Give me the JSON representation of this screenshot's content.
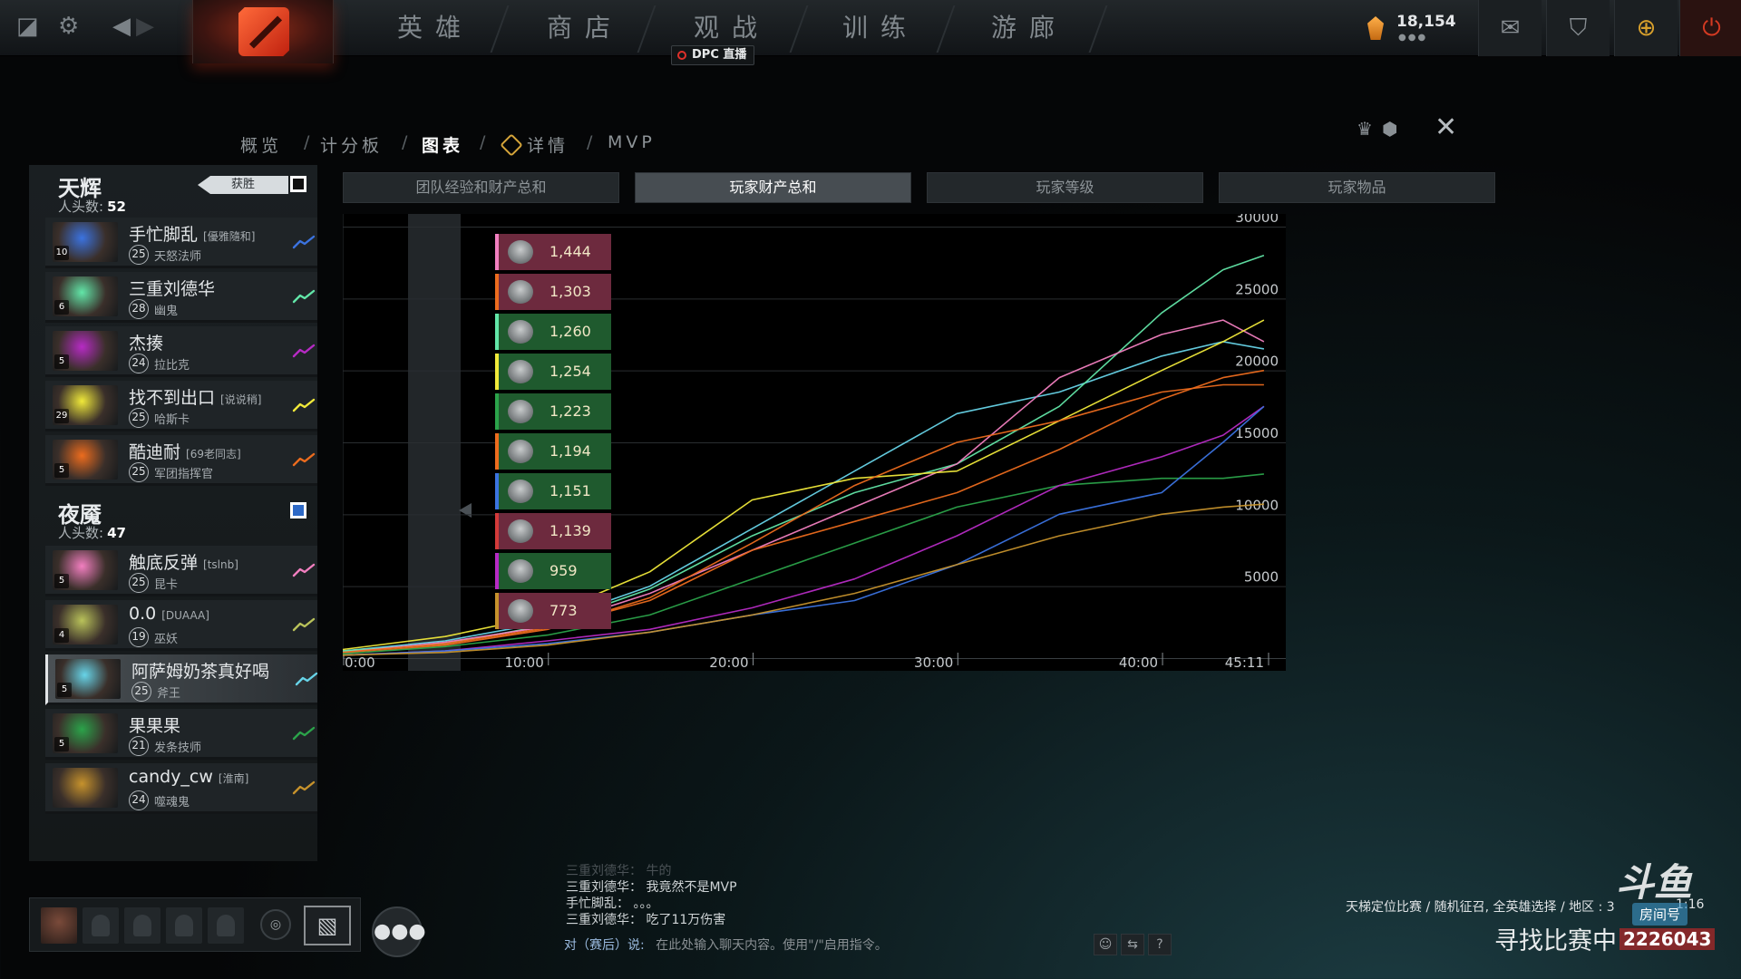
{
  "topbar": {
    "nav": [
      "英雄",
      "商店",
      "观战",
      "训练",
      "游廊"
    ],
    "dpc_badge": "DPC 直播",
    "shards": "18,154"
  },
  "crumbs": {
    "overview": "概览",
    "scoreboard": "计分板",
    "graphs": "图表",
    "details": "详情",
    "mvp": "MVP",
    "sep": "/"
  },
  "teams": {
    "radiant": {
      "name": "天辉",
      "kills_label": "人头数:",
      "kills": "52",
      "result": "获胜",
      "players": [
        {
          "name": "手忙脚乱",
          "tag": "[優雅隨和]",
          "level": "25",
          "hero": "天怒法师",
          "portrait_level": "10",
          "color": "#3b73e0"
        },
        {
          "name": "三重刘德华",
          "tag": "",
          "level": "28",
          "hero": "幽鬼",
          "portrait_level": "6",
          "color": "#62e6a8"
        },
        {
          "name": "杰揍",
          "tag": "",
          "level": "24",
          "hero": "拉比克",
          "portrait_level": "5",
          "color": "#b62bc4"
        },
        {
          "name": "找不到出口",
          "tag": "[说说稍]",
          "level": "25",
          "hero": "哈斯卡",
          "portrait_level": "29",
          "color": "#f0e93a"
        },
        {
          "name": "酷迪耐",
          "tag": "[69老同志]",
          "level": "25",
          "hero": "军团指挥官",
          "portrait_level": "5",
          "color": "#ec6c1e"
        }
      ]
    },
    "dire": {
      "name": "夜魇",
      "kills_label": "人头数:",
      "kills": "47",
      "players": [
        {
          "name": "触底反弹",
          "tag": "[tslnb]",
          "level": "25",
          "hero": "昆卡",
          "portrait_level": "5",
          "color": "#f27fc0"
        },
        {
          "name": "0.0",
          "tag": "[DUAAA]",
          "level": "19",
          "hero": "巫妖",
          "portrait_level": "4",
          "color": "#b9c25a"
        },
        {
          "name": "阿萨姆奶茶真好喝",
          "tag": "",
          "level": "25",
          "hero": "斧王",
          "portrait_level": "5",
          "color": "#67d4e8"
        },
        {
          "name": "果果果",
          "tag": "",
          "level": "21",
          "hero": "发条技师",
          "portrait_level": "5",
          "color": "#2ba34a"
        },
        {
          "name": "candy_cw",
          "tag": "[淮南]",
          "level": "24",
          "hero": "噬魂鬼",
          "portrait_level": "",
          "color": "#c6922c"
        }
      ]
    }
  },
  "chart_tabs": [
    "团队经验和财产总和",
    "玩家财产总和",
    "玩家等级",
    "玩家物品"
  ],
  "legend": [
    {
      "value": "1,444",
      "color": "#f27fc0",
      "bg": "#6d2a3e"
    },
    {
      "value": "1,303",
      "color": "#ec6c1e",
      "bg": "#6d2a3e"
    },
    {
      "value": "1,260",
      "color": "#62e6a8",
      "bg": "#1f5a2e"
    },
    {
      "value": "1,254",
      "color": "#f0e93a",
      "bg": "#1f5a2e"
    },
    {
      "value": "1,223",
      "color": "#2ba34a",
      "bg": "#1f5a2e"
    },
    {
      "value": "1,194",
      "color": "#ec6c1e",
      "bg": "#1f5a2e"
    },
    {
      "value": "1,151",
      "color": "#3b73e0",
      "bg": "#1f5a2e"
    },
    {
      "value": "1,139",
      "color": "#d33a3a",
      "bg": "#6d2a3e"
    },
    {
      "value": "959",
      "color": "#b62bc4",
      "bg": "#1f5a2e"
    },
    {
      "value": "773",
      "color": "#c6922c",
      "bg": "#6d2a3e"
    }
  ],
  "chart_data": {
    "type": "line",
    "x_ticks": [
      "0:00",
      "10:00",
      "20:00",
      "30:00",
      "40:00",
      "45:11"
    ],
    "y_ticks": [
      "5000",
      "10000",
      "15000",
      "20000",
      "25000",
      "30000"
    ],
    "xlim": [
      0,
      45.18
    ],
    "ylim": [
      0,
      30000
    ],
    "series": [
      {
        "color": "#67d4e8",
        "points": [
          [
            0,
            500
          ],
          [
            5,
            1200
          ],
          [
            10,
            2500
          ],
          [
            15,
            5000
          ],
          [
            20,
            9000
          ],
          [
            25,
            13000
          ],
          [
            30,
            17000
          ],
          [
            35,
            18500
          ],
          [
            40,
            21000
          ],
          [
            43,
            22000
          ],
          [
            45,
            21500
          ]
        ]
      },
      {
        "color": "#62e6a8",
        "points": [
          [
            0,
            500
          ],
          [
            5,
            1000
          ],
          [
            10,
            2300
          ],
          [
            15,
            4800
          ],
          [
            20,
            8500
          ],
          [
            25,
            11500
          ],
          [
            30,
            13500
          ],
          [
            35,
            17500
          ],
          [
            40,
            24000
          ],
          [
            43,
            27000
          ],
          [
            45,
            28000
          ]
        ]
      },
      {
        "color": "#f27fc0",
        "points": [
          [
            0,
            400
          ],
          [
            5,
            1100
          ],
          [
            10,
            2200
          ],
          [
            15,
            4500
          ],
          [
            20,
            7500
          ],
          [
            25,
            10500
          ],
          [
            30,
            13500
          ],
          [
            35,
            19500
          ],
          [
            40,
            22500
          ],
          [
            43,
            23500
          ],
          [
            45,
            22000
          ]
        ]
      },
      {
        "color": "#f0e93a",
        "points": [
          [
            0,
            600
          ],
          [
            5,
            1500
          ],
          [
            10,
            3000
          ],
          [
            15,
            6000
          ],
          [
            20,
            11000
          ],
          [
            25,
            12500
          ],
          [
            30,
            13000
          ],
          [
            35,
            16500
          ],
          [
            40,
            20000
          ],
          [
            43,
            22000
          ],
          [
            45,
            23500
          ]
        ]
      },
      {
        "color": "#ec6c1e",
        "points": [
          [
            0,
            400
          ],
          [
            5,
            1000
          ],
          [
            10,
            2100
          ],
          [
            15,
            4000
          ],
          [
            20,
            7500
          ],
          [
            25,
            9500
          ],
          [
            30,
            11500
          ],
          [
            35,
            14500
          ],
          [
            40,
            18000
          ],
          [
            43,
            19500
          ],
          [
            45,
            20000
          ]
        ]
      },
      {
        "color": "#ec6c1e",
        "points": [
          [
            0,
            300
          ],
          [
            5,
            900
          ],
          [
            10,
            2000
          ],
          [
            15,
            4200
          ],
          [
            20,
            8000
          ],
          [
            25,
            12000
          ],
          [
            30,
            15000
          ],
          [
            35,
            16500
          ],
          [
            40,
            18500
          ],
          [
            43,
            19000
          ],
          [
            45,
            19000
          ]
        ]
      },
      {
        "color": "#2ba34a",
        "points": [
          [
            0,
            300
          ],
          [
            5,
            800
          ],
          [
            10,
            1600
          ],
          [
            15,
            3000
          ],
          [
            20,
            5500
          ],
          [
            25,
            8000
          ],
          [
            30,
            10500
          ],
          [
            35,
            12000
          ],
          [
            40,
            12500
          ],
          [
            43,
            12500
          ],
          [
            45,
            12800
          ]
        ]
      },
      {
        "color": "#b62bc4",
        "points": [
          [
            0,
            200
          ],
          [
            5,
            500
          ],
          [
            10,
            1200
          ],
          [
            15,
            2000
          ],
          [
            20,
            3500
          ],
          [
            25,
            5500
          ],
          [
            30,
            8500
          ],
          [
            35,
            12000
          ],
          [
            40,
            14000
          ],
          [
            43,
            15500
          ],
          [
            45,
            17500
          ]
        ]
      },
      {
        "color": "#3b73e0",
        "points": [
          [
            0,
            200
          ],
          [
            5,
            500
          ],
          [
            10,
            1000
          ],
          [
            15,
            1800
          ],
          [
            20,
            3000
          ],
          [
            25,
            4000
          ],
          [
            30,
            6500
          ],
          [
            35,
            10000
          ],
          [
            40,
            11500
          ],
          [
            43,
            15000
          ],
          [
            45,
            17500
          ]
        ]
      },
      {
        "color": "#c6922c",
        "points": [
          [
            0,
            200
          ],
          [
            5,
            400
          ],
          [
            10,
            900
          ],
          [
            15,
            1800
          ],
          [
            20,
            3000
          ],
          [
            25,
            4500
          ],
          [
            30,
            6500
          ],
          [
            35,
            8500
          ],
          [
            40,
            10000
          ],
          [
            43,
            10500
          ],
          [
            45,
            10700
          ]
        ]
      }
    ]
  },
  "chat": {
    "lines": [
      {
        "who": "三重刘德华",
        "msg": "牛的",
        "fade": true
      },
      {
        "who": "三重刘德华",
        "msg": "我竟然不是MVP",
        "fade": false
      },
      {
        "who": "手忙脚乱",
        "msg": "。。。",
        "fade": false
      },
      {
        "who": "三重刘德华",
        "msg": "吃了11万伤害",
        "fade": false
      }
    ],
    "input_to": "对（赛后）说:",
    "input_placeholder": "在此处输入聊天内容。使用\"/\"启用指令。"
  },
  "matchmaking": {
    "info": "天梯定位比赛 / 随机征召, 全英雄选择 / 地区 : 3",
    "time": "1:16",
    "status": "寻找比赛中"
  },
  "overlay": {
    "watermark": "斗鱼",
    "sub": "房间号",
    "room": "2226043"
  }
}
